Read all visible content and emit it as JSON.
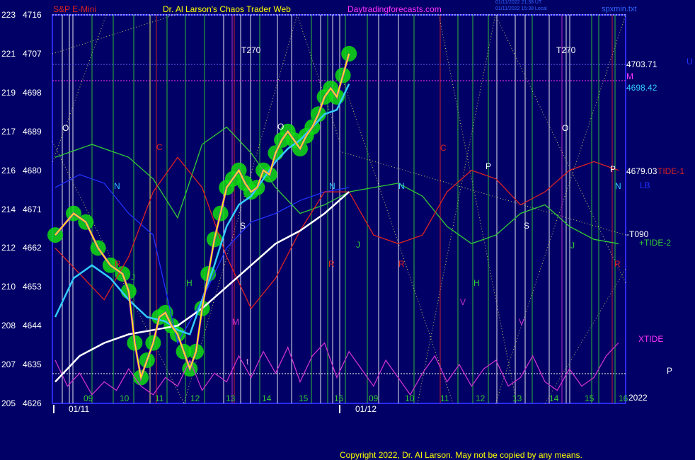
{
  "header": {
    "instrument": "S&P E-Mini",
    "site": "Dr. Al Larson's Chaos Trader Web",
    "url": "Daytradingforecasts.com",
    "stamp1": "01/11/2022 21:38 UT",
    "stamp2": "01/11/2022 15:38 Local",
    "file": "spxmin.txt"
  },
  "colors": {
    "background": "#000066",
    "frame": "#2a2aff",
    "price_yellow": "#ffff00",
    "ema_cyan": "#33ccff",
    "long_white": "#ffffff",
    "tide_green": "#33cc33",
    "xtide_magenta": "#cc33cc",
    "red_line": "#dd2222",
    "blue_line": "#2233ff",
    "marker_green": "#11dd11"
  },
  "footer": {
    "copyright": "Copyright 2022, Dr. Al Larson. May not be copied by any means."
  },
  "right_labels": {
    "level_top": "4703.71",
    "m_label": "M",
    "level_mid": "4698.42",
    "level_low": "4679.03",
    "tide1": "TIDE-1",
    "lb": "LB",
    "t090": "-T090",
    "tide2": "+TIDE-2",
    "xtide": "XTIDE",
    "p_label": "P",
    "corner_u": "U",
    "year": "2022"
  },
  "chart_data": {
    "type": "line",
    "title": "S&P E-Mini",
    "y_ticks": [
      {
        "left": "223",
        "price": "4716"
      },
      {
        "left": "221",
        "price": "4707"
      },
      {
        "left": "219",
        "price": "4698"
      },
      {
        "left": "217",
        "price": "4689"
      },
      {
        "left": "216",
        "price": "4680"
      },
      {
        "left": "214",
        "price": "4671"
      },
      {
        "left": "212",
        "price": "4662"
      },
      {
        "left": "210",
        "price": "4653"
      },
      {
        "left": "208",
        "price": "4644"
      },
      {
        "left": "207",
        "price": "4635"
      },
      {
        "left": "205",
        "price": "4626"
      }
    ],
    "ylim": [
      4626,
      4716
    ],
    "x_ticks_day1": [
      "09",
      "10",
      "11",
      "12",
      "13",
      "14",
      "15",
      "16"
    ],
    "x_ticks_day2": [
      "09",
      "10",
      "11",
      "12",
      "13",
      "14",
      "15",
      "16"
    ],
    "dates": [
      "01/11",
      "01/12"
    ],
    "planet_markers": [
      {
        "text": "T270",
        "color": "#ffffff"
      },
      {
        "text": "T270",
        "color": "#ffffff"
      },
      {
        "text": "O",
        "color": "#ffffff"
      },
      {
        "text": "O",
        "color": "#ffffff"
      },
      {
        "text": "O",
        "color": "#ffffff"
      },
      {
        "text": "C",
        "color": "#dd2222"
      },
      {
        "text": "C",
        "color": "#dd2222"
      },
      {
        "text": "N",
        "color": "#33ccff"
      },
      {
        "text": "N",
        "color": "#33ccff"
      },
      {
        "text": "N",
        "color": "#33ccff"
      },
      {
        "text": "N",
        "color": "#33ccff"
      },
      {
        "text": "P",
        "color": "#ffffff"
      },
      {
        "text": "P",
        "color": "#ffffff"
      },
      {
        "text": "S",
        "color": "#ffffff"
      },
      {
        "text": "S",
        "color": "#ffffff"
      },
      {
        "text": "R",
        "color": "#dd2222"
      },
      {
        "text": "R",
        "color": "#dd2222"
      },
      {
        "text": "R",
        "color": "#dd2222"
      },
      {
        "text": "R",
        "color": "#dd2222"
      },
      {
        "text": "H",
        "color": "#33cc33"
      },
      {
        "text": "H",
        "color": "#33cc33"
      },
      {
        "text": "J",
        "color": "#33cc33"
      },
      {
        "text": "J",
        "color": "#33cc33"
      },
      {
        "text": "J",
        "color": "#33cc33"
      },
      {
        "text": "M",
        "color": "#cc33cc"
      },
      {
        "text": "V",
        "color": "#cc33cc"
      },
      {
        "text": "V",
        "color": "#cc33cc"
      },
      {
        "text": "t",
        "color": "#cc99cc"
      }
    ],
    "series": [
      {
        "name": "price",
        "color": "#ffff00",
        "values": [
          [
            0,
            4665
          ],
          [
            3,
            4670
          ],
          [
            5,
            4668
          ],
          [
            7,
            4662
          ],
          [
            9,
            4658
          ],
          [
            11,
            4656
          ],
          [
            12,
            4652
          ],
          [
            13,
            4640
          ],
          [
            14,
            4632
          ],
          [
            15,
            4636
          ],
          [
            16,
            4640
          ],
          [
            17,
            4646
          ],
          [
            18,
            4647
          ],
          [
            19,
            4644
          ],
          [
            20,
            4642
          ],
          [
            21,
            4638
          ],
          [
            22,
            4634
          ],
          [
            23,
            4638
          ],
          [
            24,
            4648
          ],
          [
            25,
            4656
          ],
          [
            26,
            4664
          ],
          [
            27,
            4670
          ],
          [
            28,
            4676
          ],
          [
            29,
            4678
          ],
          [
            30,
            4680
          ],
          [
            31,
            4677
          ],
          [
            32,
            4675
          ],
          [
            33,
            4676
          ],
          [
            34,
            4680
          ],
          [
            35,
            4679
          ],
          [
            36,
            4684
          ],
          [
            37,
            4687
          ],
          [
            38,
            4689
          ],
          [
            39,
            4687
          ],
          [
            40,
            4685
          ],
          [
            41,
            4688
          ],
          [
            42,
            4690
          ],
          [
            43,
            4693
          ],
          [
            44,
            4697
          ],
          [
            45,
            4699
          ],
          [
            46,
            4697
          ],
          [
            47,
            4702
          ],
          [
            48,
            4707
          ]
        ]
      },
      {
        "name": "ema",
        "color": "#33ccff",
        "values": [
          [
            0,
            4646
          ],
          [
            3,
            4655
          ],
          [
            6,
            4658
          ],
          [
            9,
            4655
          ],
          [
            12,
            4650
          ],
          [
            15,
            4646
          ],
          [
            18,
            4645
          ],
          [
            20,
            4643
          ],
          [
            22,
            4642
          ],
          [
            24,
            4650
          ],
          [
            26,
            4658
          ],
          [
            28,
            4667
          ],
          [
            30,
            4672
          ],
          [
            32,
            4674
          ],
          [
            34,
            4678
          ],
          [
            36,
            4682
          ],
          [
            38,
            4685
          ],
          [
            40,
            4687
          ],
          [
            42,
            4690
          ],
          [
            44,
            4693
          ],
          [
            46,
            4694
          ],
          [
            48,
            4700
          ]
        ]
      },
      {
        "name": "long",
        "color": "#ffffff",
        "values": [
          [
            0,
            4631
          ],
          [
            4,
            4637
          ],
          [
            8,
            4640
          ],
          [
            12,
            4642
          ],
          [
            16,
            4643
          ],
          [
            20,
            4644
          ],
          [
            24,
            4648
          ],
          [
            28,
            4653
          ],
          [
            32,
            4658
          ],
          [
            36,
            4663
          ],
          [
            40,
            4666
          ],
          [
            44,
            4670
          ],
          [
            48,
            4675
          ]
        ]
      },
      {
        "name": "TIDE-2",
        "color": "#33cc33",
        "values": [
          [
            0,
            4683
          ],
          [
            6,
            4686
          ],
          [
            12,
            4683
          ],
          [
            16,
            4678
          ],
          [
            20,
            4669
          ],
          [
            24,
            4686
          ],
          [
            28,
            4690
          ],
          [
            32,
            4684
          ],
          [
            36,
            4676
          ],
          [
            40,
            4670
          ],
          [
            44,
            4672
          ],
          [
            48,
            4675
          ],
          [
            52,
            4676
          ],
          [
            56,
            4677
          ],
          [
            60,
            4674
          ],
          [
            64,
            4667
          ],
          [
            68,
            4663
          ],
          [
            72,
            4665
          ],
          [
            76,
            4670
          ],
          [
            80,
            4672
          ],
          [
            84,
            4667
          ],
          [
            88,
            4664
          ],
          [
            92,
            4663
          ]
        ]
      },
      {
        "name": "TIDE-1",
        "color": "#dd2222",
        "values": [
          [
            0,
            4662
          ],
          [
            4,
            4656
          ],
          [
            8,
            4650
          ],
          [
            12,
            4660
          ],
          [
            16,
            4675
          ],
          [
            20,
            4683
          ],
          [
            24,
            4676
          ],
          [
            28,
            4660
          ],
          [
            32,
            4648
          ],
          [
            36,
            4655
          ],
          [
            40,
            4666
          ],
          [
            44,
            4675
          ],
          [
            48,
            4675
          ],
          [
            52,
            4665
          ],
          [
            56,
            4663
          ],
          [
            60,
            4665
          ],
          [
            64,
            4675
          ],
          [
            68,
            4680
          ],
          [
            72,
            4678
          ],
          [
            76,
            4672
          ],
          [
            80,
            4675
          ],
          [
            84,
            4680
          ],
          [
            88,
            4682
          ],
          [
            92,
            4680
          ]
        ]
      },
      {
        "name": "LB",
        "color": "#2233ff",
        "values": [
          [
            0,
            4676
          ],
          [
            4,
            4679
          ],
          [
            8,
            4677
          ],
          [
            12,
            4670
          ],
          [
            16,
            4665
          ],
          [
            20,
            4640
          ],
          [
            24,
            4650
          ],
          [
            28,
            4662
          ],
          [
            32,
            4668
          ],
          [
            36,
            4670
          ],
          [
            40,
            4673
          ],
          [
            44,
            4675
          ],
          [
            48,
            4676
          ]
        ]
      },
      {
        "name": "XTIDE",
        "color": "#cc33cc",
        "values": [
          [
            0,
            4636
          ],
          [
            2,
            4630
          ],
          [
            4,
            4633
          ],
          [
            6,
            4628
          ],
          [
            8,
            4631
          ],
          [
            10,
            4629
          ],
          [
            12,
            4634
          ],
          [
            14,
            4630
          ],
          [
            16,
            4628
          ],
          [
            18,
            4632
          ],
          [
            20,
            4630
          ],
          [
            22,
            4636
          ],
          [
            24,
            4629
          ],
          [
            26,
            4633
          ],
          [
            28,
            4631
          ],
          [
            30,
            4637
          ],
          [
            32,
            4632
          ],
          [
            34,
            4638
          ],
          [
            36,
            4633
          ],
          [
            38,
            4639
          ],
          [
            40,
            4631
          ],
          [
            42,
            4637
          ],
          [
            44,
            4640
          ],
          [
            46,
            4632
          ],
          [
            48,
            4638
          ],
          [
            50,
            4634
          ],
          [
            52,
            4630
          ],
          [
            54,
            4636
          ],
          [
            56,
            4632
          ],
          [
            58,
            4628
          ],
          [
            60,
            4633
          ],
          [
            62,
            4637
          ],
          [
            64,
            4631
          ],
          [
            66,
            4635
          ],
          [
            68,
            4630
          ],
          [
            70,
            4634
          ],
          [
            72,
            4636
          ],
          [
            74,
            4630
          ],
          [
            76,
            4632
          ],
          [
            78,
            4637
          ],
          [
            80,
            4631
          ],
          [
            82,
            4629
          ],
          [
            84,
            4634
          ],
          [
            86,
            4630
          ],
          [
            88,
            4632
          ],
          [
            90,
            4637
          ],
          [
            92,
            4640
          ]
        ]
      }
    ]
  }
}
